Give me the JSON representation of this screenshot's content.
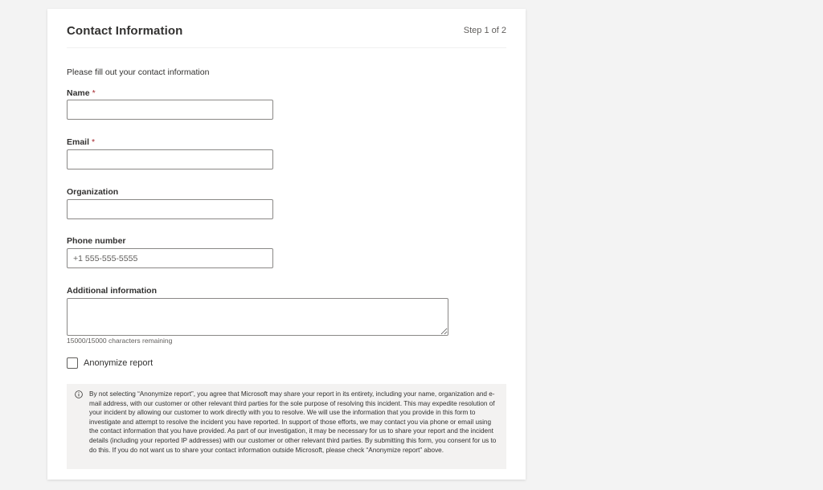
{
  "header": {
    "title": "Contact Information",
    "step": "Step 1 of 2"
  },
  "form": {
    "intro": "Please fill out your contact information",
    "required_marker": "*",
    "name": {
      "label": "Name",
      "value": "",
      "placeholder": ""
    },
    "email": {
      "label": "Email",
      "value": "",
      "placeholder": ""
    },
    "organization": {
      "label": "Organization",
      "value": "",
      "placeholder": ""
    },
    "phone": {
      "label": "Phone number",
      "value": "",
      "placeholder": "+1 555-555-5555"
    },
    "additional": {
      "label": "Additional information",
      "value": "",
      "counter": "15000/15000 characters remaining"
    },
    "anonymize": {
      "label": "Anonymize report",
      "checked": false
    }
  },
  "notice": {
    "icon": "info-icon",
    "text": "By not selecting “Anonymize report”, you agree that Microsoft may share your report in its entirety, including your name, organization and e-mail address, with our customer or other relevant third parties for the sole purpose of resolving this incident. This may expedite resolution of your incident by allowing our customer to work directly with you to resolve. We will use the information that you provide in this form to investigate and attempt to resolve the incident you have reported. In support of those efforts, we may contact you via phone or email using the contact information that you have provided. As part of our investigation, it may be necessary for us to share your report and the incident details (including your reported IP addresses) with our customer or other relevant third parties. By submitting this form, you consent for us to do this. If you do not want us to share your contact information outside Microsoft, please check “Anonymize report” above."
  },
  "colors": {
    "background": "#f3f3f3",
    "card": "#ffffff",
    "required": "#a4262c",
    "notice_bg": "#f3f2f1",
    "border": "#8a8886"
  }
}
